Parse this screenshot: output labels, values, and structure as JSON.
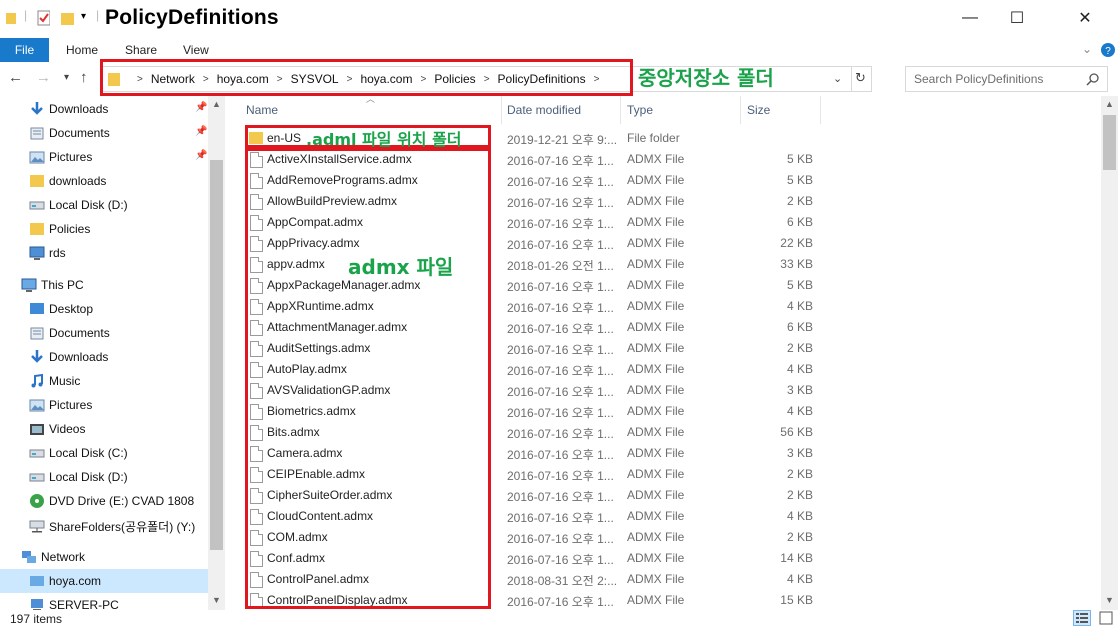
{
  "window": {
    "title": "PolicyDefinitions",
    "minimize": "—",
    "maximize": "☐",
    "close": "✕"
  },
  "ribbon": {
    "file": "File",
    "tabs": [
      "Home",
      "Share",
      "View"
    ]
  },
  "address": {
    "crumbs": [
      "Network",
      "hoya.com",
      "SYSVOL",
      "hoya.com",
      "Policies",
      "PolicyDefinitions"
    ],
    "search_placeholder": "Search PolicyDefinitions"
  },
  "nav": {
    "quick": [
      {
        "label": "Downloads",
        "icon": "download-arrow-icon",
        "pinned": true
      },
      {
        "label": "Documents",
        "icon": "documents-icon",
        "pinned": true
      },
      {
        "label": "Pictures",
        "icon": "pictures-icon",
        "pinned": true
      },
      {
        "label": "downloads",
        "icon": "folder-icon",
        "pinned": false
      },
      {
        "label": "Local Disk (D:)",
        "icon": "drive-icon",
        "pinned": false
      },
      {
        "label": "Policies",
        "icon": "folder-icon",
        "pinned": false
      },
      {
        "label": "rds",
        "icon": "monitor-icon",
        "pinned": false
      }
    ],
    "thispc": {
      "label": "This PC",
      "items": [
        {
          "label": "Desktop",
          "icon": "desktop-icon"
        },
        {
          "label": "Documents",
          "icon": "documents-icon"
        },
        {
          "label": "Downloads",
          "icon": "download-arrow-icon"
        },
        {
          "label": "Music",
          "icon": "music-icon"
        },
        {
          "label": "Pictures",
          "icon": "pictures-icon"
        },
        {
          "label": "Videos",
          "icon": "videos-icon"
        },
        {
          "label": "Local Disk (C:)",
          "icon": "drive-icon"
        },
        {
          "label": "Local Disk (D:)",
          "icon": "drive-icon"
        },
        {
          "label": "DVD Drive (E:) CVAD 1808",
          "icon": "dvd-icon"
        },
        {
          "label": "ShareFolders(공유폴더) (Y:)",
          "icon": "network-drive-icon"
        }
      ]
    },
    "network": {
      "label": "Network",
      "items": [
        {
          "label": "hoya.com",
          "selected": true
        },
        {
          "label": "SERVER-PC",
          "selected": false
        }
      ]
    }
  },
  "columns": {
    "name": "Name",
    "date": "Date modified",
    "type": "Type",
    "size": "Size"
  },
  "files": [
    {
      "name": "en-US",
      "date": "2019-12-21 오후 9:...",
      "type": "File folder",
      "size": "",
      "folder": true
    },
    {
      "name": "ActiveXInstallService.admx",
      "date": "2016-07-16 오후 1...",
      "type": "ADMX File",
      "size": "5 KB"
    },
    {
      "name": "AddRemovePrograms.admx",
      "date": "2016-07-16 오후 1...",
      "type": "ADMX File",
      "size": "5 KB"
    },
    {
      "name": "AllowBuildPreview.admx",
      "date": "2016-07-16 오후 1...",
      "type": "ADMX File",
      "size": "2 KB"
    },
    {
      "name": "AppCompat.admx",
      "date": "2016-07-16 오후 1...",
      "type": "ADMX File",
      "size": "6 KB"
    },
    {
      "name": "AppPrivacy.admx",
      "date": "2016-07-16 오후 1...",
      "type": "ADMX File",
      "size": "22 KB"
    },
    {
      "name": "appv.admx",
      "date": "2018-01-26 오전 1...",
      "type": "ADMX File",
      "size": "33 KB"
    },
    {
      "name": "AppxPackageManager.admx",
      "date": "2016-07-16 오후 1...",
      "type": "ADMX File",
      "size": "5 KB"
    },
    {
      "name": "AppXRuntime.admx",
      "date": "2016-07-16 오후 1...",
      "type": "ADMX File",
      "size": "4 KB"
    },
    {
      "name": "AttachmentManager.admx",
      "date": "2016-07-16 오후 1...",
      "type": "ADMX File",
      "size": "6 KB"
    },
    {
      "name": "AuditSettings.admx",
      "date": "2016-07-16 오후 1...",
      "type": "ADMX File",
      "size": "2 KB"
    },
    {
      "name": "AutoPlay.admx",
      "date": "2016-07-16 오후 1...",
      "type": "ADMX File",
      "size": "4 KB"
    },
    {
      "name": "AVSValidationGP.admx",
      "date": "2016-07-16 오후 1...",
      "type": "ADMX File",
      "size": "3 KB"
    },
    {
      "name": "Biometrics.admx",
      "date": "2016-07-16 오후 1...",
      "type": "ADMX File",
      "size": "4 KB"
    },
    {
      "name": "Bits.admx",
      "date": "2016-07-16 오후 1...",
      "type": "ADMX File",
      "size": "56 KB"
    },
    {
      "name": "Camera.admx",
      "date": "2016-07-16 오후 1...",
      "type": "ADMX File",
      "size": "3 KB"
    },
    {
      "name": "CEIPEnable.admx",
      "date": "2016-07-16 오후 1...",
      "type": "ADMX File",
      "size": "2 KB"
    },
    {
      "name": "CipherSuiteOrder.admx",
      "date": "2016-07-16 오후 1...",
      "type": "ADMX File",
      "size": "2 KB"
    },
    {
      "name": "CloudContent.admx",
      "date": "2016-07-16 오후 1...",
      "type": "ADMX File",
      "size": "4 KB"
    },
    {
      "name": "COM.admx",
      "date": "2016-07-16 오후 1...",
      "type": "ADMX File",
      "size": "2 KB"
    },
    {
      "name": "Conf.admx",
      "date": "2016-07-16 오후 1...",
      "type": "ADMX File",
      "size": "14 KB"
    },
    {
      "name": "ControlPanel.admx",
      "date": "2018-08-31 오전 2:...",
      "type": "ADMX File",
      "size": "4 KB"
    },
    {
      "name": "ControlPanelDisplay.admx",
      "date": "2016-07-16 오후 1...",
      "type": "ADMX File",
      "size": "15 KB"
    }
  ],
  "status": {
    "items": "197 items"
  },
  "annotations": {
    "central_store": "중앙저장소 폴더",
    "adml": ".adml  파일 위치 폴더",
    "admx": "admx  파일"
  },
  "colors": {
    "annotation_red": "#e0171f",
    "annotation_green": "#1aa34a",
    "file_tab": "#1979ca",
    "selection": "#cce8ff"
  }
}
